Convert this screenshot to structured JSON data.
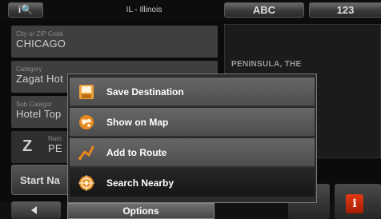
{
  "topbar": {
    "info_label": "i🔍",
    "state": "IL - Illinois",
    "tabs": [
      "ABC",
      "123"
    ]
  },
  "fields": {
    "city": {
      "label": "City or ZIP Code",
      "value": "CHICAGO"
    },
    "category": {
      "label": "Category",
      "value": "Zagat Hot"
    },
    "subcategory": {
      "label": "Sub Categor",
      "value": "Hotel Top"
    },
    "name": {
      "label": "Nam",
      "value": "PE",
      "icon_letter": "Z"
    }
  },
  "result": {
    "title": "PENINSULA, THE"
  },
  "start_nav": {
    "label": "Start Na"
  },
  "popup": {
    "items": [
      {
        "label": "Save Destination",
        "icon": "save-destination-icon"
      },
      {
        "label": "Show on Map",
        "icon": "globe-icon"
      },
      {
        "label": "Add to Route",
        "icon": "route-icon"
      },
      {
        "label": "Search Nearby",
        "icon": "target-icon",
        "selected": true
      }
    ]
  },
  "options": {
    "label": "Options"
  },
  "info_icon": {
    "label": "i"
  },
  "colors": {
    "accent": "#e8891d",
    "info": "#d2310c"
  }
}
